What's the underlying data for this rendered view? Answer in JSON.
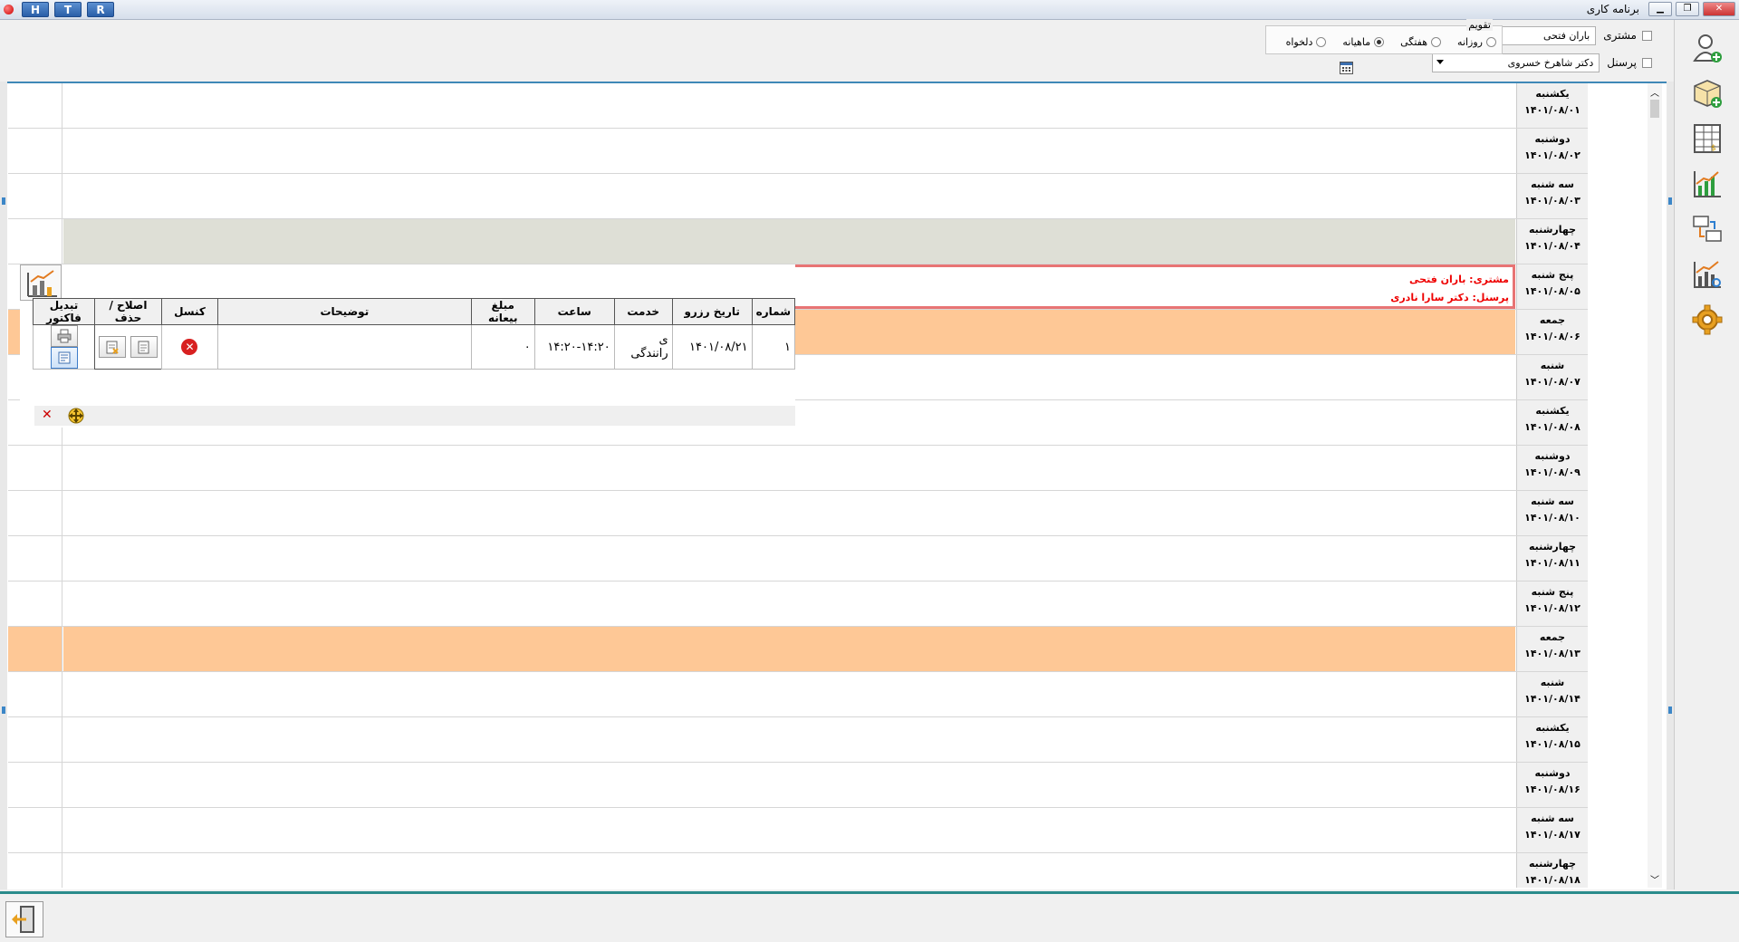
{
  "window": {
    "title": "برنامه کاری",
    "htr_buttons": [
      "H",
      "T",
      "R"
    ]
  },
  "filters": {
    "customer_label": "مشتری",
    "customer_value": "باران فتحی",
    "personnel_label": "پرسنل",
    "personnel_value": "دکتر شاهرخ خسروی",
    "calendar_legend": "تقویم",
    "calendar_options": [
      {
        "label": "روزانه",
        "selected": false
      },
      {
        "label": "هفتگی",
        "selected": false
      },
      {
        "label": "ماهیانه",
        "selected": true
      },
      {
        "label": "دلخواه",
        "selected": false
      }
    ]
  },
  "days": [
    {
      "name": "یکشنبه",
      "date": "۱۴۰۱/۰۸/۰۱",
      "style": "normal"
    },
    {
      "name": "دوشنبه",
      "date": "۱۴۰۱/۰۸/۰۲",
      "style": "normal"
    },
    {
      "name": "سه شنبه",
      "date": "۱۴۰۱/۰۸/۰۳",
      "style": "normal"
    },
    {
      "name": "چهارشنبه",
      "date": "۱۴۰۱/۰۸/۰۴",
      "style": "gray"
    },
    {
      "name": "پنج شنبه",
      "date": "۱۴۰۱/۰۸/۰۵",
      "style": "active"
    },
    {
      "name": "جمعه",
      "date": "۱۴۰۱/۰۸/۰۶",
      "style": "orange"
    },
    {
      "name": "شنبه",
      "date": "۱۴۰۱/۰۸/۰۷",
      "style": "normal"
    },
    {
      "name": "یکشنبه",
      "date": "۱۴۰۱/۰۸/۰۸",
      "style": "normal"
    },
    {
      "name": "دوشنبه",
      "date": "۱۴۰۱/۰۸/۰۹",
      "style": "normal"
    },
    {
      "name": "سه شنبه",
      "date": "۱۴۰۱/۰۸/۱۰",
      "style": "normal"
    },
    {
      "name": "چهارشنبه",
      "date": "۱۴۰۱/۰۸/۱۱",
      "style": "normal"
    },
    {
      "name": "پنج شنبه",
      "date": "۱۴۰۱/۰۸/۱۲",
      "style": "normal"
    },
    {
      "name": "جمعه",
      "date": "۱۴۰۱/۰۸/۱۳",
      "style": "orange"
    },
    {
      "name": "شنبه",
      "date": "۱۴۰۱/۰۸/۱۴",
      "style": "normal"
    },
    {
      "name": "یکشنبه",
      "date": "۱۴۰۱/۰۸/۱۵",
      "style": "normal"
    },
    {
      "name": "دوشنبه",
      "date": "۱۴۰۱/۰۸/۱۶",
      "style": "normal"
    },
    {
      "name": "سه شنبه",
      "date": "۱۴۰۱/۰۸/۱۷",
      "style": "normal"
    },
    {
      "name": "چهارشنبه",
      "date": "۱۴۰۱/۰۸/۱۸",
      "style": "normal"
    }
  ],
  "active_appointment": {
    "customer_line": "مشتری: باران فتحی",
    "personnel_line": "پرسنل: دکتر سارا نادری"
  },
  "popup_table": {
    "headers": {
      "number": "شماره",
      "reserve_date": "تاریخ رزرو",
      "service": "خدمت",
      "time": "ساعت",
      "deposit": "مبلغ بیعانه",
      "description": "توضیحات",
      "cancel": "کنسل",
      "edit_delete": "اصلاح / حذف",
      "convert_invoice": "تبدیل فاکتور"
    },
    "row": {
      "number": "۱",
      "reserve_date": "۱۴۰۱/۰۸/۲۱",
      "service": "ی رانندگی",
      "time": "۱۴:۲۰-۱۴:۲۰",
      "deposit": "۰",
      "description": ""
    }
  },
  "icons": {
    "toolbar": [
      "add-user-icon",
      "add-package-icon",
      "price-table-icon",
      "bar-chart-icon",
      "transfer-icon",
      "analytics-icon",
      "settings-gear-icon"
    ]
  },
  "colors": {
    "orange_row": "#fec896",
    "gray_row": "#dedfd6",
    "active_border": "#e87474",
    "accent": "#3f88b7"
  }
}
